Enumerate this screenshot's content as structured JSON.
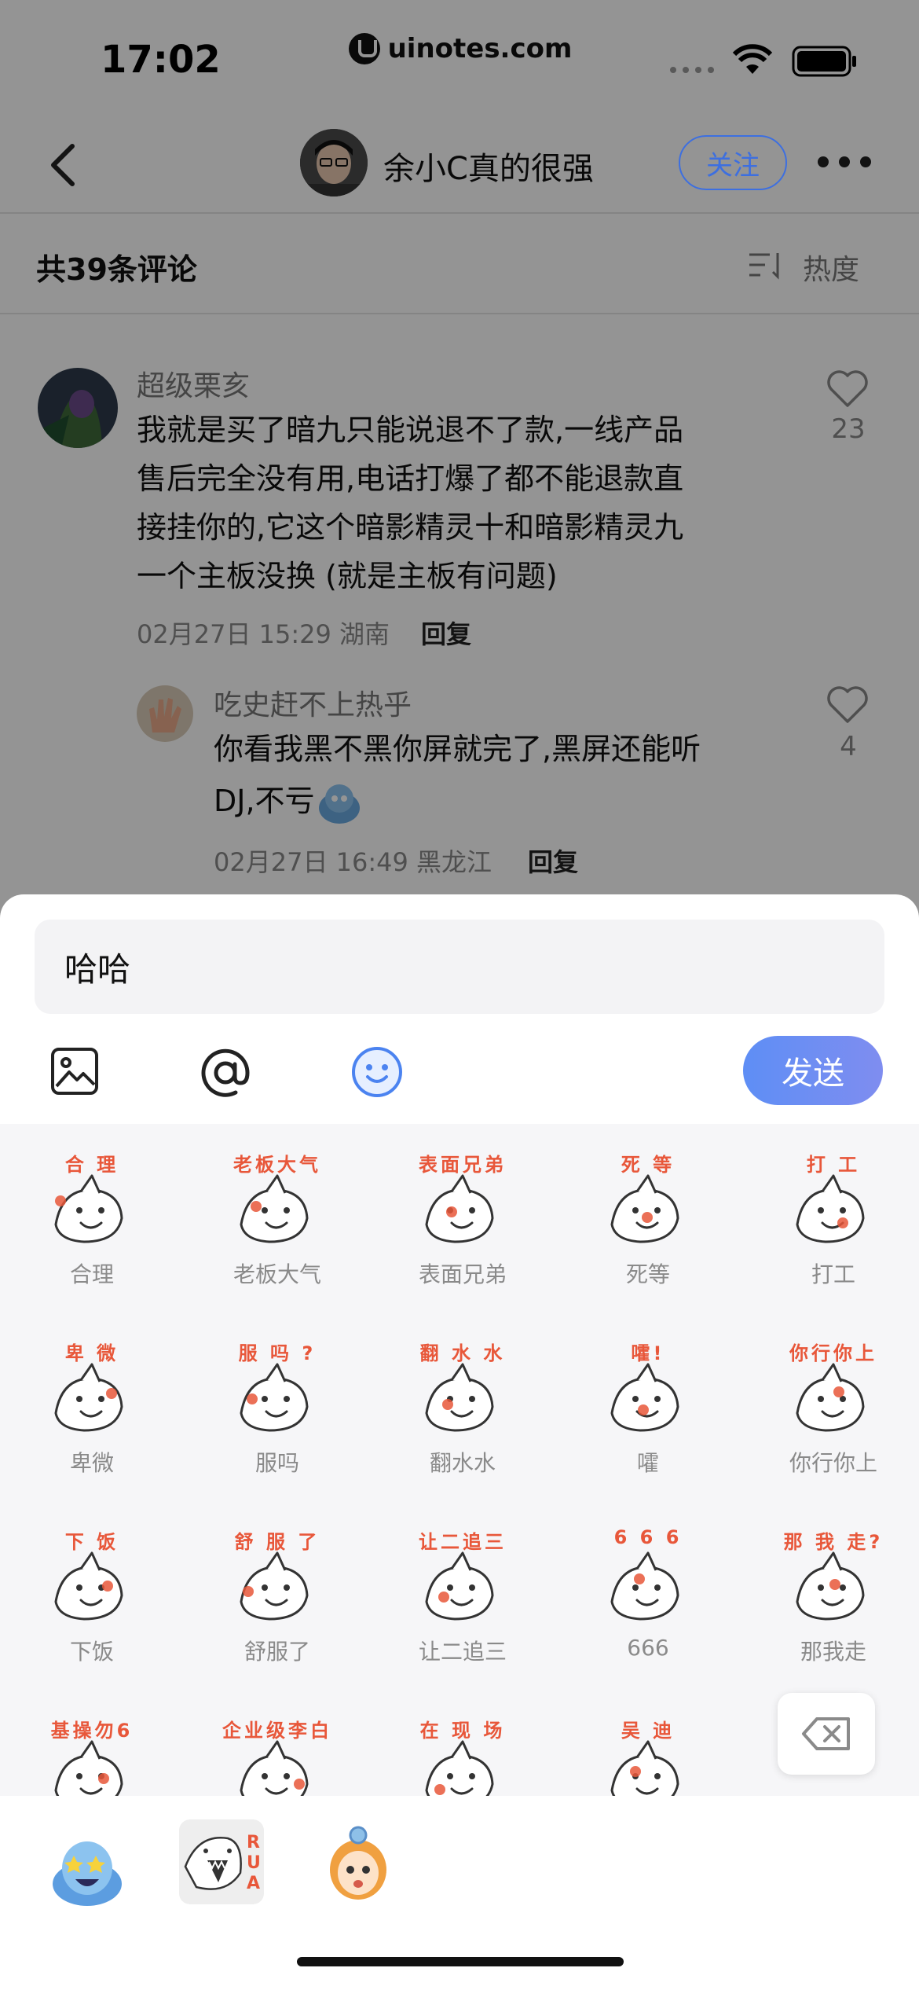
{
  "status_bar": {
    "time": "17:02",
    "url_pill": "uinotes.com"
  },
  "header": {
    "username": "余小C真的很强",
    "follow_label": "关注",
    "more_icon": "more-icon",
    "back_icon": "back-chevron-icon"
  },
  "comments_bar": {
    "count_label": "共39条评论",
    "sort_label": "热度"
  },
  "comments": [
    {
      "user": "超级栗亥",
      "text_lines": [
        "我就是买了暗九只能说退不了款,一线产品",
        "售后完全没有用,电话打爆了都不能退款直",
        "接挂你的,它这个暗影精灵十和暗影精灵九",
        "一个主板没换 (就是主板有问题)"
      ],
      "meta": "02月27日 15:29 湖南",
      "reply_label": "回复",
      "likes": "23"
    },
    {
      "user": "吃史赶不上热乎",
      "text_lines": [
        "你看我黑不黑你屏就完了,黑屏还能听",
        "DJ,不亏"
      ],
      "meta": "02月27日 16:49 黑龙江",
      "reply_label": "回复",
      "likes": "4"
    }
  ],
  "composer": {
    "input_value": "哈哈",
    "send_label": "发送",
    "tools": [
      "image-icon",
      "at-icon",
      "emoji-icon"
    ]
  },
  "stickers": [
    {
      "label": "合理",
      "caption_top": "合 理"
    },
    {
      "label": "老板大气",
      "caption_top": "老板大气"
    },
    {
      "label": "表面兄弟",
      "caption_top": "表面兄弟"
    },
    {
      "label": "死等",
      "caption_top": "死 等"
    },
    {
      "label": "打工",
      "caption_top": "打 工"
    },
    {
      "label": "卑微",
      "caption_top": "卑 微"
    },
    {
      "label": "服吗",
      "caption_top": "服 吗 ?"
    },
    {
      "label": "翻水水",
      "caption_top": "翻 水 水"
    },
    {
      "label": "嚯",
      "caption_top": "嚯!"
    },
    {
      "label": "你行你上",
      "caption_top": "你行你上"
    },
    {
      "label": "下饭",
      "caption_top": "下 饭"
    },
    {
      "label": "舒服了",
      "caption_top": "舒 服 了"
    },
    {
      "label": "让二追三",
      "caption_top": "让二追三"
    },
    {
      "label": "666",
      "caption_top": "6 6 6"
    },
    {
      "label": "那我走",
      "caption_top": "那 我 走?"
    },
    {
      "label": "",
      "caption_top": "基操勿6"
    },
    {
      "label": "",
      "caption_top": "企业级李白"
    },
    {
      "label": "",
      "caption_top": "在 现 场"
    },
    {
      "label": "",
      "caption_top": "吴 迪"
    }
  ],
  "sticker_tabs": [
    {
      "name": "blob-sticker-pack-tab",
      "selected": false
    },
    {
      "name": "shark-rua-sticker-pack-tab",
      "selected": true,
      "text": "RUA"
    },
    {
      "name": "girl-sticker-pack-tab",
      "selected": false
    }
  ],
  "colors": {
    "accent": "#3d6fe0",
    "sticker_red": "#e8573a",
    "send_gradient_start": "#5e8ef5"
  }
}
